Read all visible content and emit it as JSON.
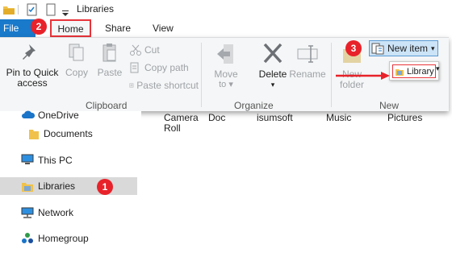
{
  "window": {
    "title": "Libraries"
  },
  "ribbon": {
    "tabs": {
      "file": "File",
      "home": "Home",
      "share": "Share",
      "view": "View"
    },
    "clipboard": {
      "group_label": "Clipboard",
      "pin_label_1": "Pin to Quick",
      "pin_label_2": "access",
      "copy": "Copy",
      "paste": "Paste",
      "cut": "Cut",
      "copy_path": "Copy path",
      "paste_shortcut": "Paste shortcut"
    },
    "organize": {
      "group_label": "Organize",
      "move_to_1": "Move",
      "move_to_2": "to",
      "delete": "Delete",
      "rename": "Rename"
    },
    "new": {
      "group_label": "New",
      "new_folder_1": "New",
      "new_folder_2": "folder",
      "new_item": "New item",
      "dropdown_item": "Library"
    }
  },
  "badges": {
    "one": "1",
    "two": "2",
    "three": "3"
  },
  "nav": {
    "items": [
      {
        "label": "OneDrive"
      },
      {
        "label": "Documents"
      },
      {
        "label": "This PC"
      },
      {
        "label": "Libraries"
      },
      {
        "label": "Network"
      },
      {
        "label": "Homegroup"
      }
    ]
  },
  "content": {
    "items": [
      {
        "line1": "Camera",
        "line2": "Roll"
      },
      {
        "line1": "Doc",
        "line2": ""
      },
      {
        "line1": "isumsoft",
        "line2": ""
      },
      {
        "line1": "Music",
        "line2": ""
      },
      {
        "line1": "Pictures",
        "line2": ""
      }
    ]
  },
  "colors": {
    "accent": "#1979ca",
    "annotation_red": "#e8222a",
    "selected_bg": "#d9d9d9"
  }
}
